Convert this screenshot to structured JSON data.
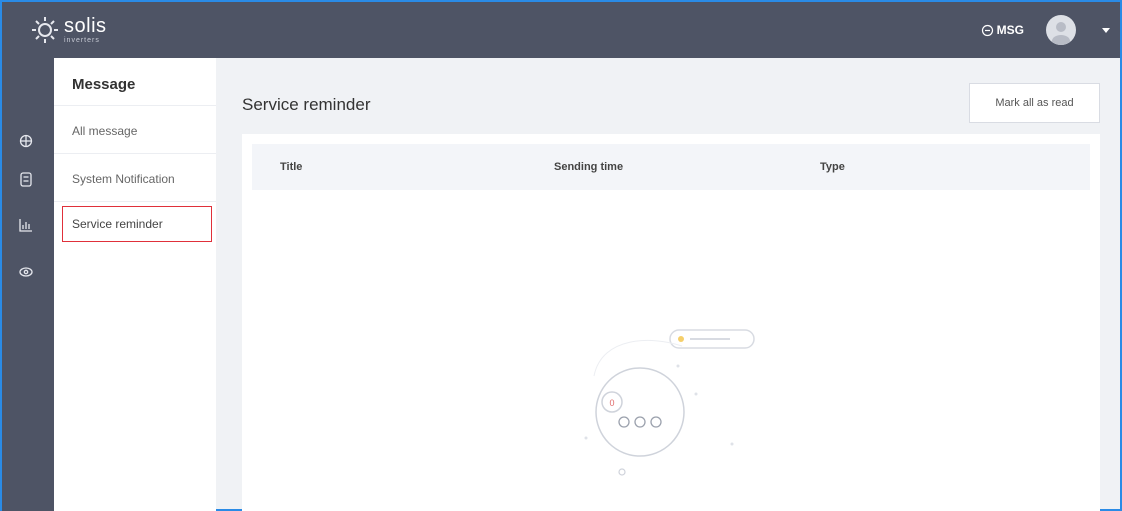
{
  "header": {
    "logo_word": "solis",
    "logo_sub": "inverters",
    "msg_label": "MSG",
    "icons": [
      "sun-logo-icon",
      "chat-bubble-icon",
      "avatar-icon",
      "caret-down-icon"
    ]
  },
  "rail": {
    "icons": [
      "globe-icon",
      "device-icon",
      "chart-icon",
      "eye-icon"
    ]
  },
  "submenu": {
    "title": "Message",
    "items": [
      {
        "label": "All message"
      },
      {
        "label": "System Notification"
      },
      {
        "label": "Service reminder"
      }
    ],
    "active_index": 2
  },
  "main": {
    "title": "Service reminder",
    "mark_all_label": "Mark all as read",
    "columns": [
      "Title",
      "Sending time",
      "Type"
    ],
    "rows": [],
    "empty_state_icon": "empty-chat-illustration"
  },
  "colors": {
    "topbar": "#4e5465",
    "accent_border": "#e0303a",
    "window_border": "#2a8be6"
  }
}
